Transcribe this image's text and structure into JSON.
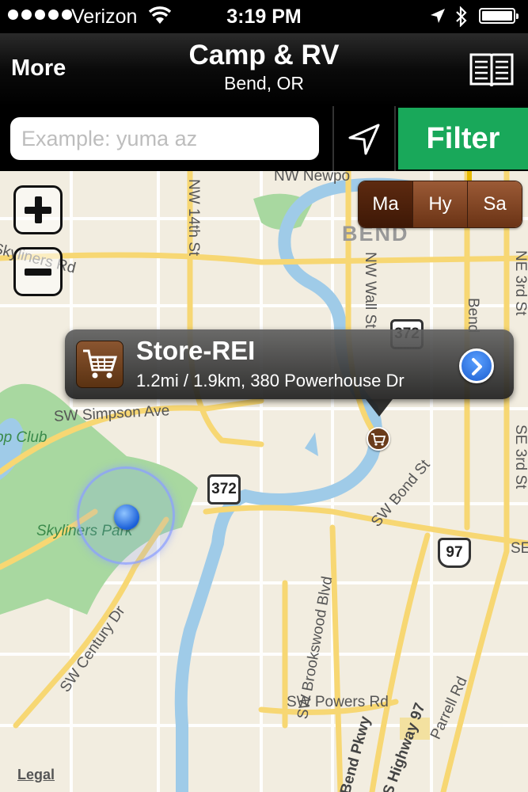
{
  "status": {
    "carrier": "Verizon",
    "time": "3:19 PM"
  },
  "navbar": {
    "left_label": "More",
    "title": "Camp & RV",
    "subtitle": "Bend, OR"
  },
  "search": {
    "placeholder": "Example: yuma az",
    "value": "",
    "filter_label": "Filter"
  },
  "map": {
    "map_types": [
      "Ma",
      "Hy",
      "Sa"
    ],
    "selected_type": "Ma",
    "callout": {
      "title": "Store-REI",
      "detail": "1.2mi / 1.9km, 380 Powerhouse Dr"
    },
    "legal_label": "Legal",
    "labels": {
      "nw_newport": "NW Newpo",
      "nw_14th": "NW 14th St",
      "bend": "BEND",
      "nw_wall": "NW Wall St",
      "skyliners_rd": "Skyliners Rd",
      "ne_3rd": "NE 3rd St",
      "bend_right": "Bend",
      "sw_simpson": "SW Simpson Ave",
      "club": "pp Club",
      "skyliners_park": "Skyliners Park",
      "sw_bond": "SW Bond St",
      "se_3rd": "SE 3rd St",
      "se_right": "SE",
      "sw_century": "SW Century Dr",
      "sw_brookswood": "SW Brookswood Blvd",
      "sw_powers": "SW Powers Rd",
      "bend_pkwy": "Bend Pkwy",
      "s_highway": "S Highway 97",
      "parrell": "Parrell Rd"
    },
    "shields": {
      "hwy372_top": "372",
      "hwy372_mid": "372",
      "hwy97": "97"
    },
    "colors": {
      "land": "#f2ede0",
      "park": "#a8d8a0",
      "water": "#9fcbe8",
      "major_road": "#f7d773",
      "filter_green": "#19a85a"
    }
  }
}
